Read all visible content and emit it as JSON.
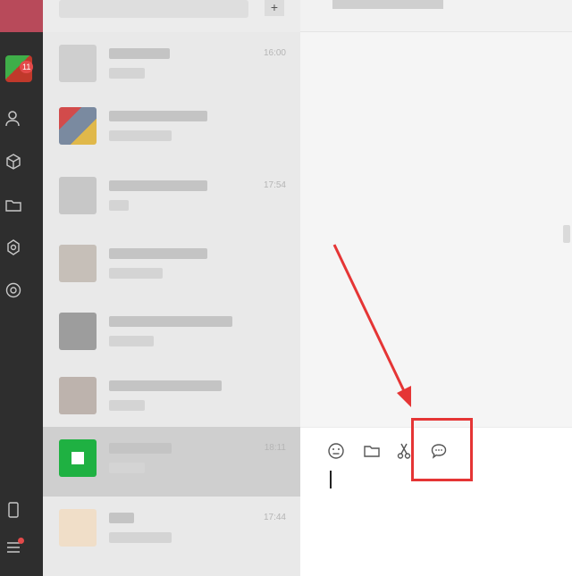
{
  "sidebar": {
    "badge_count": "11",
    "icons": [
      "avatar",
      "contacts-icon",
      "cube-icon",
      "folder-icon",
      "mini-program-icon",
      "moments-icon",
      "phone-icon",
      "menu-icon"
    ]
  },
  "session_list": {
    "add_button": "+",
    "rows": [
      {
        "time": "16:00",
        "thumb": "#cfcfcf"
      },
      {
        "time": "",
        "thumb": "#b7b7b7"
      },
      {
        "time": "17:54",
        "thumb": "#c7c7c7"
      },
      {
        "time": "",
        "thumb": "#c6bfb8"
      },
      {
        "time": "",
        "thumb": "#9d9d9d"
      },
      {
        "time": "",
        "thumb": "#bdb3ad"
      },
      {
        "time": "18:11",
        "thumb": "#1fb142"
      },
      {
        "time": "17:44",
        "thumb": "#f0dec8"
      }
    ]
  },
  "chat": {
    "toolbar": [
      "emoji-icon",
      "file-icon",
      "screenshot-icon",
      "chat-history-icon"
    ]
  },
  "colors": {
    "sidebar_bg": "#2e2e2e",
    "list_bg": "#e9e9e9",
    "active_row": "#cfcfcf",
    "highlight": "#e53535"
  }
}
